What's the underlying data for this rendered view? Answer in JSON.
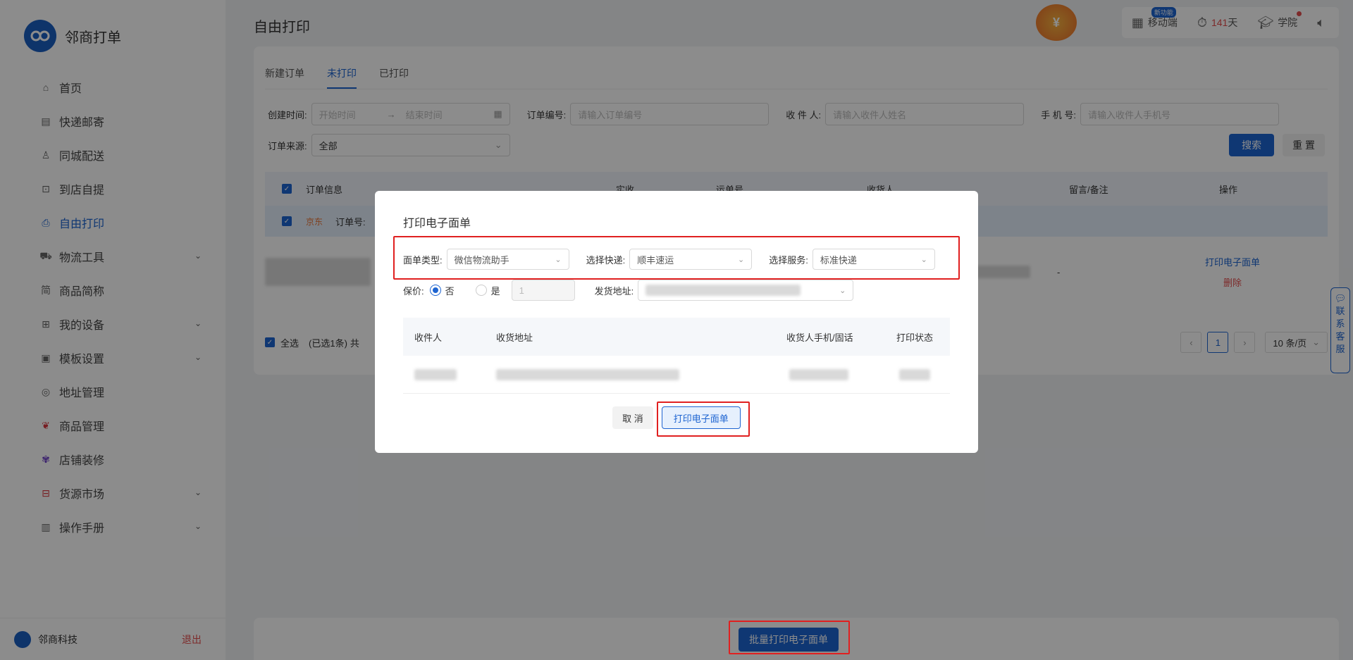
{
  "app": {
    "name": "邻商打单"
  },
  "sidebar": {
    "items": [
      {
        "label": "首页",
        "icon": "home-icon"
      },
      {
        "label": "快递邮寄",
        "icon": "list-icon"
      },
      {
        "label": "同城配送",
        "icon": "courier-icon"
      },
      {
        "label": "到店自提",
        "icon": "store-icon"
      },
      {
        "label": "自由打印",
        "icon": "printer-icon"
      },
      {
        "label": "物流工具",
        "icon": "truck-icon"
      },
      {
        "label": "商品简称",
        "icon": "tag-icon"
      },
      {
        "label": "我的设备",
        "icon": "device-icon"
      },
      {
        "label": "模板设置",
        "icon": "template-icon"
      },
      {
        "label": "地址管理",
        "icon": "location-icon"
      },
      {
        "label": "商品管理",
        "icon": "goods-icon"
      },
      {
        "label": "店铺装修",
        "icon": "decor-icon"
      },
      {
        "label": "货源市场",
        "icon": "market-icon"
      },
      {
        "label": "操作手册",
        "icon": "manual-icon"
      }
    ],
    "footer": {
      "company": "邻商科技",
      "logout": "退出"
    }
  },
  "header": {
    "page_title": "自由打印",
    "mobile": "移动端",
    "mobile_badge": "新功能",
    "days_value": "141",
    "days_unit": "天",
    "academy": "学院"
  },
  "tabs": [
    "新建订单",
    "未打印",
    "已打印"
  ],
  "filters": {
    "created_label": "创建时间:",
    "start_placeholder": "开始时间",
    "end_placeholder": "结束时间",
    "order_no_label": "订单编号:",
    "order_no_placeholder": "请输入订单编号",
    "receiver_label": "收 件 人:",
    "receiver_placeholder": "请输入收件人姓名",
    "phone_label": "手 机 号:",
    "phone_placeholder": "请输入收件人手机号",
    "source_label": "订单来源:",
    "source_value": "全部",
    "search": "搜索",
    "reset": "重 置"
  },
  "table": {
    "headers": [
      "订单信息",
      "实收",
      "运单号",
      "收货人",
      "留言/备注",
      "操作"
    ],
    "order_tag": "京东",
    "order_no_label": "订单号:",
    "remark": "-",
    "op_print": "打印电子面单",
    "op_delete": "删除"
  },
  "footer_bar": {
    "select_all": "全选",
    "selected_info": "(已选1条)",
    "total_prefix": "共",
    "page": "1",
    "page_size": "10 条/页",
    "batch_print": "批量打印电子面单"
  },
  "service": {
    "label": [
      "联",
      "系",
      "客",
      "服"
    ]
  },
  "modal": {
    "title": "打印电子面单",
    "sheet_type_label": "面单类型:",
    "sheet_type_value": "微信物流助手",
    "express_label": "选择快递:",
    "express_value": "顺丰速运",
    "service_label": "选择服务:",
    "service_value": "标准快递",
    "insure_label": "保价:",
    "insure_no": "否",
    "insure_yes": "是",
    "insure_amount": "1",
    "sender_label": "发货地址:",
    "table_headers": [
      "收件人",
      "收货地址",
      "收货人手机/固话",
      "打印状态"
    ],
    "cancel": "取 消",
    "confirm": "打印电子面单"
  },
  "colors": {
    "primary": "#1d64d1",
    "danger": "#e02020"
  }
}
